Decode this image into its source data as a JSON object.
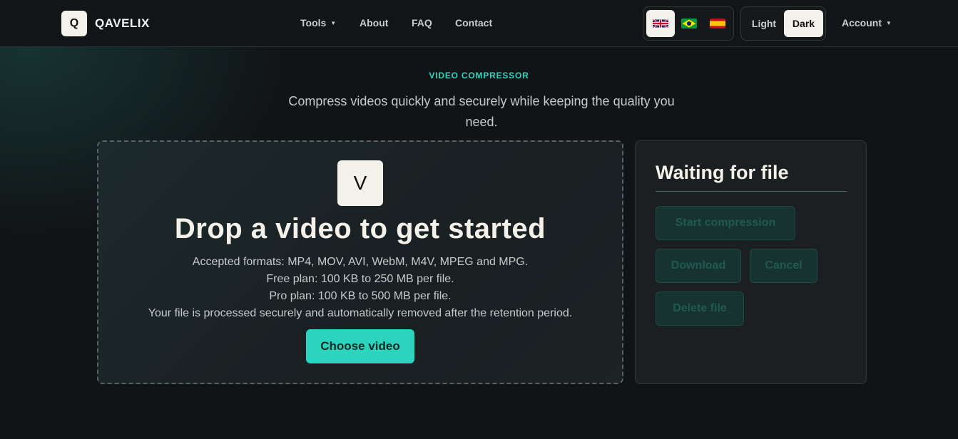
{
  "brand": {
    "logo_letter": "Q",
    "name": "QAVELIX"
  },
  "nav": {
    "tools": "Tools",
    "about": "About",
    "faq": "FAQ",
    "contact": "Contact",
    "account": "Account"
  },
  "languages": [
    "English (UK flag)",
    "Portuguese (Brazil flag)",
    "Spanish (Spain flag)"
  ],
  "theme": {
    "light": "Light",
    "dark": "Dark",
    "selected": "Dark"
  },
  "hero": {
    "eyebrow": "VIDEO COMPRESSOR",
    "subtitle": "Compress videos quickly and securely while keeping the quality you need."
  },
  "dropzone": {
    "icon_letter": "V",
    "title": "Drop a video to get started",
    "lines": [
      "Accepted formats: MP4, MOV, AVI, WebM, M4V, MPEG and MPG.",
      "Free plan: 100 KB to 250 MB per file.",
      "Pro plan: 100 KB to 500 MB per file.",
      "Your file is processed securely and automatically removed after the retention period."
    ],
    "button": "Choose video"
  },
  "panel": {
    "title": "Waiting for file",
    "start": "Start compression",
    "download": "Download",
    "cancel": "Cancel",
    "delete": "Delete file"
  },
  "colors": {
    "accent": "#2bd4bd",
    "background": "#111417",
    "tile": "#f4f1ea"
  }
}
